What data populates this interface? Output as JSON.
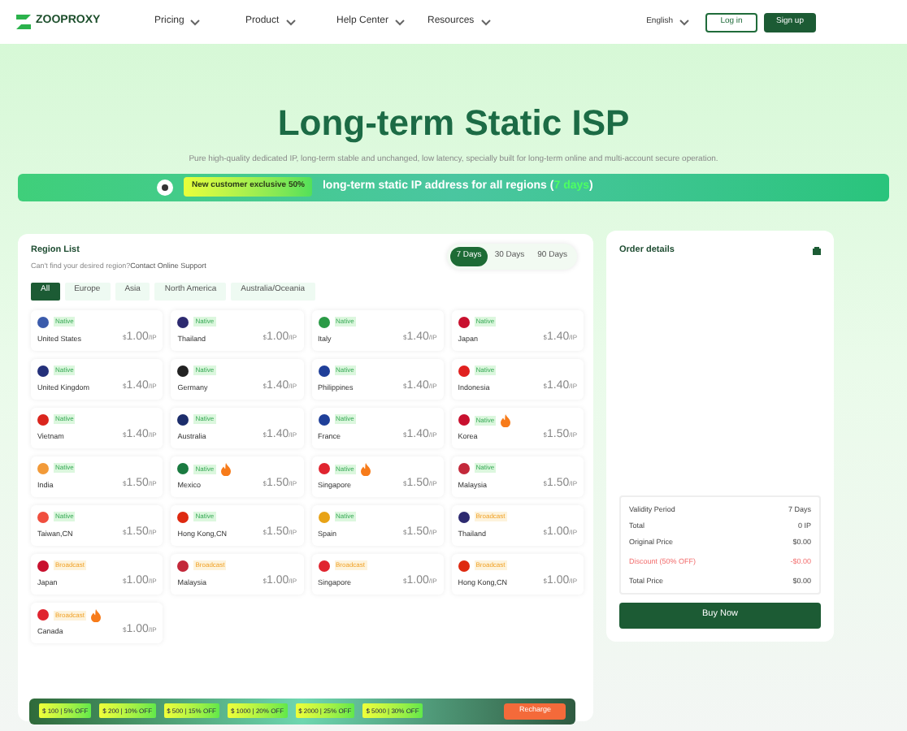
{
  "nav": {
    "brand": "ZOOPROXY",
    "menus": [
      "Pricing",
      "Product",
      "Help Center",
      "Resources"
    ],
    "language": "English",
    "login": "Log in",
    "signup": "Sign up"
  },
  "hero": {
    "title": "Long-term Static ISP",
    "subtitle": "Pure high-quality dedicated IP, long-term stable and unchanged, low latency, specially built for long-term online and multi-account secure operation.",
    "badge": "New customer exclusive 50%",
    "banner_text": "long-term static IP address for all regions (",
    "banner_highlight": "7 days",
    "banner_end": ")"
  },
  "region": {
    "title": "Region List",
    "hint": "Can't find your desired region?",
    "support_link": "Contact Online Support",
    "periods": [
      {
        "label": "7 Days",
        "selected": true
      },
      {
        "label": "30 Days",
        "selected": false
      },
      {
        "label": "90 Days",
        "selected": false
      }
    ],
    "filters": [
      {
        "label": "All",
        "selected": true
      },
      {
        "label": "Europe",
        "selected": false
      },
      {
        "label": "Asia",
        "selected": false
      },
      {
        "label": "North America",
        "selected": false
      },
      {
        "label": "Australia/Oceania",
        "selected": false
      }
    ],
    "items": [
      {
        "name": "United States",
        "tag": "Native",
        "kind": "native",
        "hot": false,
        "color": "#3b5bab",
        "currency": "$",
        "price": "1.00",
        "unit": "/IP"
      },
      {
        "name": "Thailand",
        "tag": "Native",
        "kind": "native",
        "hot": false,
        "color": "#2d2a70",
        "currency": "$",
        "price": "1.00",
        "unit": "/IP"
      },
      {
        "name": "Italy",
        "tag": "Native",
        "kind": "native",
        "hot": false,
        "color": "#2a9a46",
        "currency": "$",
        "price": "1.40",
        "unit": "/IP"
      },
      {
        "name": "Japan",
        "tag": "Native",
        "kind": "native",
        "hot": false,
        "color": "#c8102e",
        "currency": "$",
        "price": "1.40",
        "unit": "/IP"
      },
      {
        "name": "United Kingdom",
        "tag": "Native",
        "kind": "native",
        "hot": false,
        "color": "#24307a",
        "currency": "$",
        "price": "1.40",
        "unit": "/IP"
      },
      {
        "name": "Germany",
        "tag": "Native",
        "kind": "native",
        "hot": false,
        "color": "#222222",
        "currency": "$",
        "price": "1.40",
        "unit": "/IP"
      },
      {
        "name": "Philippines",
        "tag": "Native",
        "kind": "native",
        "hot": false,
        "color": "#1f3f99",
        "currency": "$",
        "price": "1.40",
        "unit": "/IP"
      },
      {
        "name": "Indonesia",
        "tag": "Native",
        "kind": "native",
        "hot": false,
        "color": "#e0201f",
        "currency": "$",
        "price": "1.40",
        "unit": "/IP"
      },
      {
        "name": "Vietnam",
        "tag": "Native",
        "kind": "native",
        "hot": false,
        "color": "#da251d",
        "currency": "$",
        "price": "1.40",
        "unit": "/IP"
      },
      {
        "name": "Australia",
        "tag": "Native",
        "kind": "native",
        "hot": false,
        "color": "#1c2d6b",
        "currency": "$",
        "price": "1.40",
        "unit": "/IP"
      },
      {
        "name": "France",
        "tag": "Native",
        "kind": "native",
        "hot": false,
        "color": "#1f3f99",
        "currency": "$",
        "price": "1.40",
        "unit": "/IP"
      },
      {
        "name": "Korea",
        "tag": "Native",
        "kind": "native",
        "hot": true,
        "color": "#c8102e",
        "currency": "$",
        "price": "1.50",
        "unit": "/IP"
      },
      {
        "name": "India",
        "tag": "Native",
        "kind": "native",
        "hot": false,
        "color": "#f29a38",
        "currency": "$",
        "price": "1.50",
        "unit": "/IP"
      },
      {
        "name": "Mexico",
        "tag": "Native",
        "kind": "native",
        "hot": true,
        "color": "#1a7a40",
        "currency": "$",
        "price": "1.50",
        "unit": "/IP"
      },
      {
        "name": "Singapore",
        "tag": "Native",
        "kind": "native",
        "hot": true,
        "color": "#e0242f",
        "currency": "$",
        "price": "1.50",
        "unit": "/IP"
      },
      {
        "name": "Malaysia",
        "tag": "Native",
        "kind": "native",
        "hot": false,
        "color": "#c3283a",
        "currency": "$",
        "price": "1.50",
        "unit": "/IP"
      },
      {
        "name": "Taiwan,CN",
        "tag": "Native",
        "kind": "native",
        "hot": false,
        "color": "#f04e3e",
        "currency": "$",
        "price": "1.50",
        "unit": "/IP"
      },
      {
        "name": "Hong Kong,CN",
        "tag": "Native",
        "kind": "native",
        "hot": false,
        "color": "#de2910",
        "currency": "$",
        "price": "1.50",
        "unit": "/IP"
      },
      {
        "name": "Spain",
        "tag": "Native",
        "kind": "native",
        "hot": false,
        "color": "#e8a317",
        "currency": "$",
        "price": "1.50",
        "unit": "/IP"
      },
      {
        "name": "Thailand",
        "tag": "Broadcast",
        "kind": "broadcast",
        "hot": false,
        "color": "#2d2a70",
        "currency": "$",
        "price": "1.00",
        "unit": "/IP"
      },
      {
        "name": "Japan",
        "tag": "Broadcast",
        "kind": "broadcast",
        "hot": false,
        "color": "#c8102e",
        "currency": "$",
        "price": "1.00",
        "unit": "/IP"
      },
      {
        "name": "Malaysia",
        "tag": "Broadcast",
        "kind": "broadcast",
        "hot": false,
        "color": "#c3283a",
        "currency": "$",
        "price": "1.00",
        "unit": "/IP"
      },
      {
        "name": "Singapore",
        "tag": "Broadcast",
        "kind": "broadcast",
        "hot": false,
        "color": "#e0242f",
        "currency": "$",
        "price": "1.00",
        "unit": "/IP"
      },
      {
        "name": "Hong Kong,CN",
        "tag": "Broadcast",
        "kind": "broadcast",
        "hot": false,
        "color": "#de2910",
        "currency": "$",
        "price": "1.00",
        "unit": "/IP"
      },
      {
        "name": "Canada",
        "tag": "Broadcast",
        "kind": "broadcast",
        "hot": true,
        "color": "#e0242f",
        "currency": "$",
        "price": "1.00",
        "unit": "/IP"
      }
    ]
  },
  "order": {
    "title": "Order details",
    "rows": [
      {
        "label": "Validity Period",
        "value": "7 Days",
        "kind": "normal"
      },
      {
        "label": "Total",
        "value": "0 IP",
        "kind": "normal"
      },
      {
        "label": "Original Price",
        "value": "$0.00",
        "kind": "normal"
      },
      {
        "label": "Discount (50% OFF)",
        "value": "-$0.00",
        "kind": "discount"
      },
      {
        "label": "Total Price",
        "value": "$0.00",
        "kind": "normal"
      }
    ],
    "button": "Buy Now"
  },
  "recharge": {
    "offers": [
      "$ 100 | 5% OFF",
      "$ 200 | 10% OFF",
      "$ 500 | 15% OFF",
      "$ 1000 | 20% OFF",
      "$ 2000 | 25% OFF",
      "$ 5000 | 30% OFF"
    ],
    "button": "Recharge"
  }
}
